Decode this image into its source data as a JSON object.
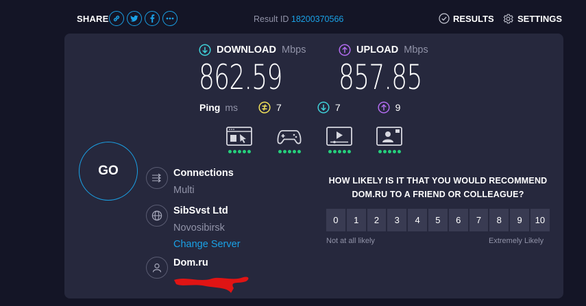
{
  "header": {
    "share_label": "SHARE",
    "share_icons": [
      "link-icon",
      "twitter-icon",
      "facebook-icon",
      "more-icon"
    ],
    "result_label": "Result ID",
    "result_id": "18200370566",
    "results_label": "RESULTS",
    "settings_label": "SETTINGS"
  },
  "download": {
    "label": "DOWNLOAD",
    "unit": "Mbps",
    "value": "862.59"
  },
  "upload": {
    "label": "UPLOAD",
    "unit": "Mbps",
    "value": "857.85"
  },
  "ping": {
    "label": "Ping",
    "unit": "ms",
    "idle": "7",
    "download": "7",
    "upload": "9"
  },
  "apps": [
    {
      "name": "web-browsing-icon",
      "rating": 5
    },
    {
      "name": "gaming-icon",
      "rating": 5
    },
    {
      "name": "video-streaming-icon",
      "rating": 5
    },
    {
      "name": "video-chat-icon",
      "rating": 5
    }
  ],
  "go_label": "GO",
  "connections": {
    "title": "Connections",
    "value": "Multi"
  },
  "server": {
    "name": "SibSvst Ltd",
    "location": "Novosibirsk",
    "change_label": "Change Server"
  },
  "isp": {
    "name": "Dom.ru"
  },
  "nps": {
    "question_line1": "HOW LIKELY IS IT THAT YOU WOULD RECOMMEND",
    "question_line2": "DOM.RU TO A FRIEND OR COLLEAGUE?",
    "scale": [
      "0",
      "1",
      "2",
      "3",
      "4",
      "5",
      "6",
      "7",
      "8",
      "9",
      "10"
    ],
    "low_label": "Not at all likely",
    "high_label": "Extremely Likely"
  },
  "colors": {
    "accent": "#1aa1e6",
    "download": "#3fd1d9",
    "upload": "#b26cf0",
    "ping_idle": "#f2e25a",
    "rating_dot": "#26d07c"
  }
}
